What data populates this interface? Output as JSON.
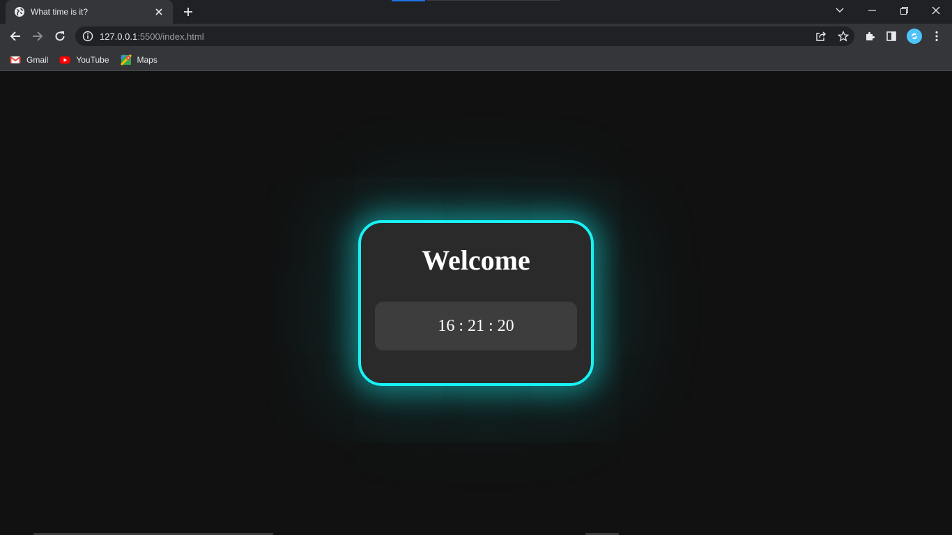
{
  "browser": {
    "tab": {
      "title": "What time is it?"
    },
    "omnibox": {
      "url_host": "127.0.0.1",
      "url_rest": ":5500/index.html"
    },
    "bookmarks": [
      {
        "label": "Gmail",
        "icon": "gmail-icon"
      },
      {
        "label": "YouTube",
        "icon": "youtube-icon"
      },
      {
        "label": "Maps",
        "icon": "maps-icon"
      }
    ]
  },
  "page": {
    "heading": "Welcome",
    "clock": "16 : 21 : 20"
  },
  "colors": {
    "accent_glow": "#17f2f5",
    "card_bg": "#2a2a2a",
    "clock_bg": "#3d3d3d",
    "page_bg": "#111111"
  }
}
